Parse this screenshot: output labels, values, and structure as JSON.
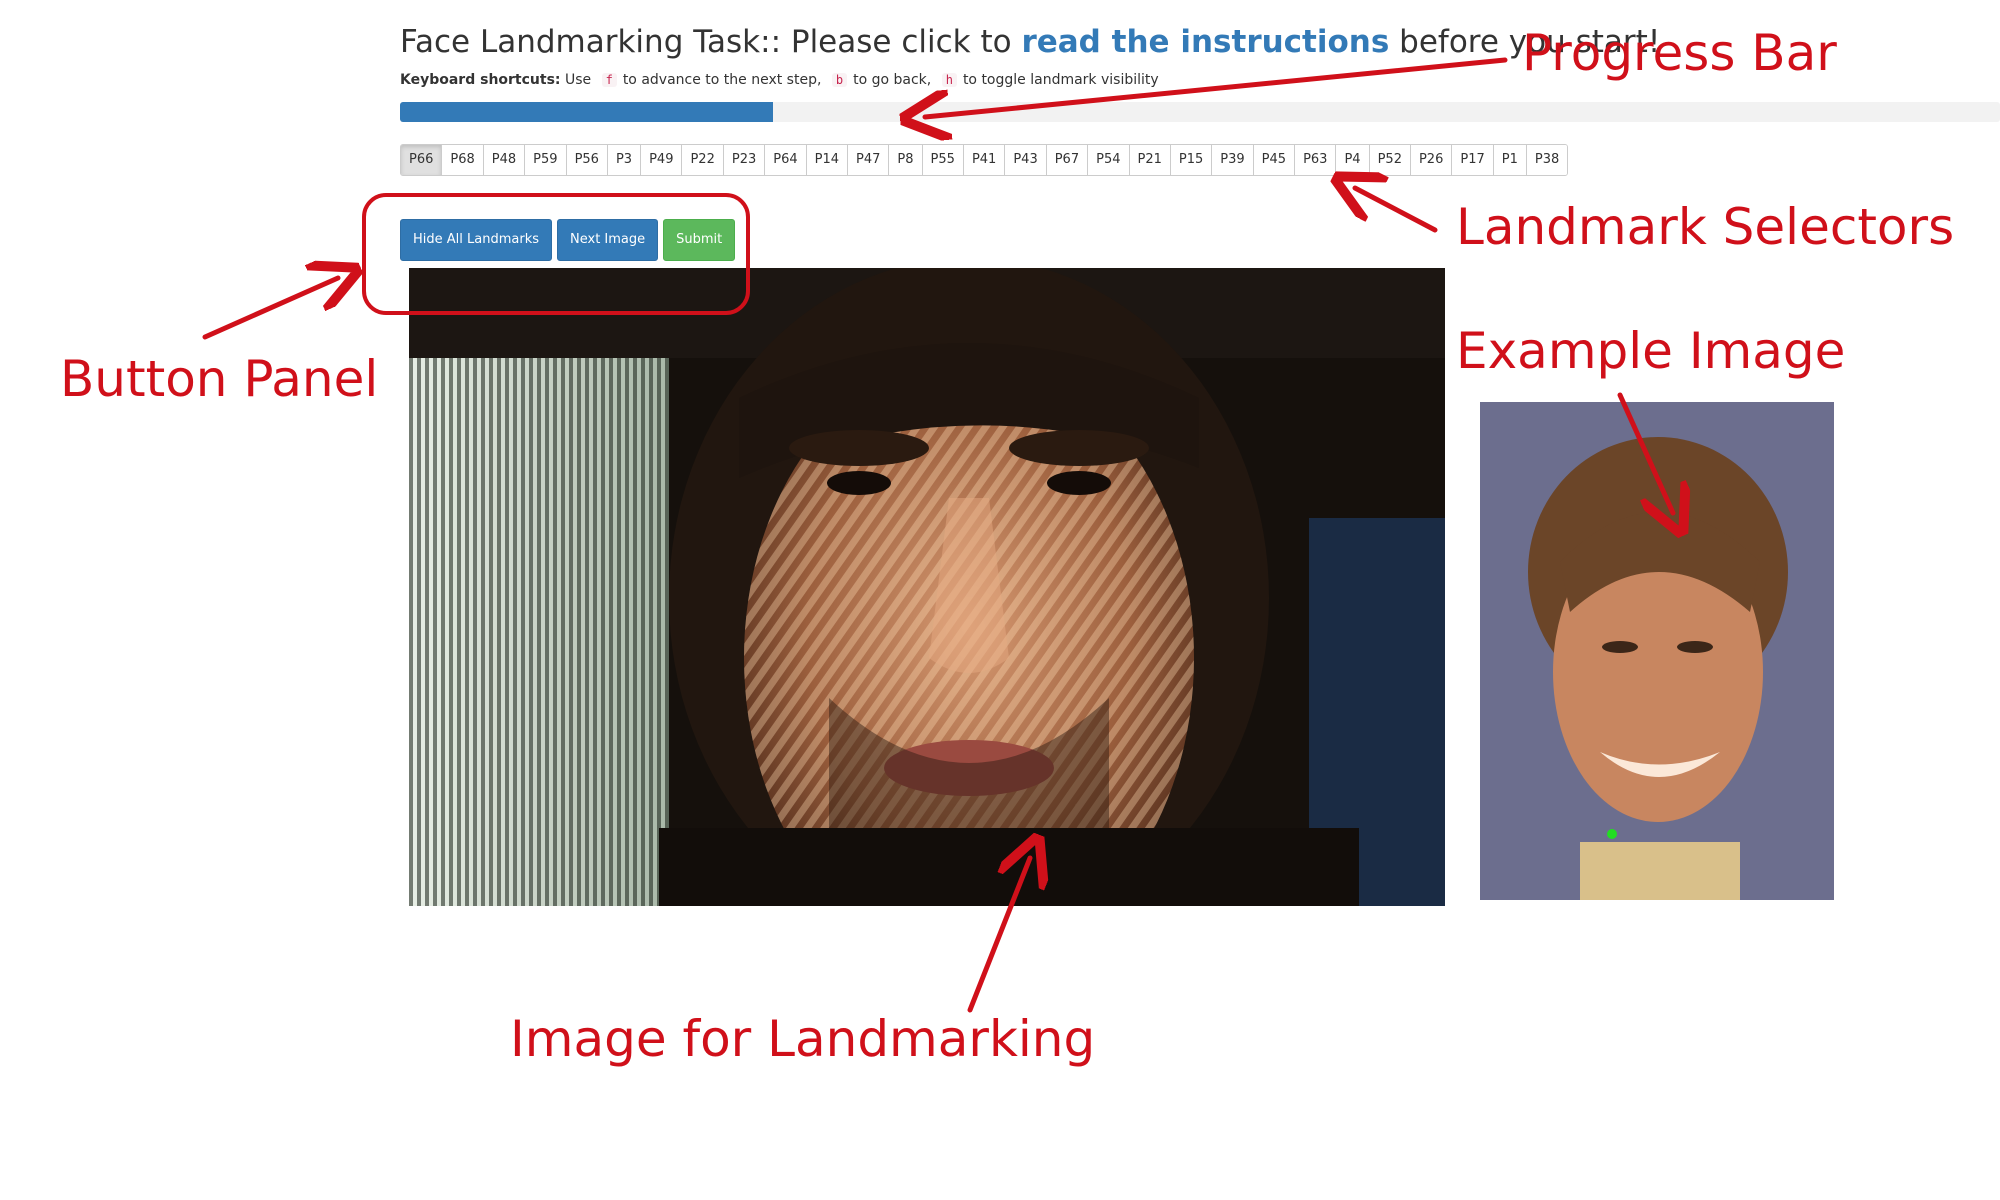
{
  "header": {
    "title_prefix": "Face Landmarking Task:: Please click to ",
    "title_link": "read the instructions",
    "title_suffix": " before you start!",
    "shortcuts_label": "Keyboard shortcuts:",
    "shortcuts_use": "Use",
    "key_forward": "f",
    "forward_text": "to advance to the next step,",
    "key_back": "b",
    "back_text": "to go back,",
    "key_toggle": "h",
    "toggle_text": "to toggle landmark visibility"
  },
  "progress": {
    "fraction": 0.233
  },
  "landmarks": {
    "items": [
      "P66",
      "P68",
      "P48",
      "P59",
      "P56",
      "P3",
      "P49",
      "P22",
      "P23",
      "P64",
      "P14",
      "P47",
      "P8",
      "P55",
      "P41",
      "P43",
      "P67",
      "P54",
      "P21",
      "P15",
      "P39",
      "P45",
      "P63",
      "P4",
      "P52",
      "P26",
      "P17",
      "P1",
      "P38"
    ],
    "active": "P66"
  },
  "buttons": {
    "hide_all": "Hide All Landmarks",
    "next_image": "Next Image",
    "submit": "Submit"
  },
  "annotations": {
    "progress_bar": "Progress Bar",
    "landmark_selectors": "Landmark Selectors",
    "button_panel": "Button Panel",
    "example_image": "Example Image",
    "image_for_landmarking": "Image for Landmarking"
  },
  "colors": {
    "primary": "#337ab7",
    "success": "#5cb85c",
    "annotation": "#d0101a",
    "landmark_point": "#22dd22"
  }
}
